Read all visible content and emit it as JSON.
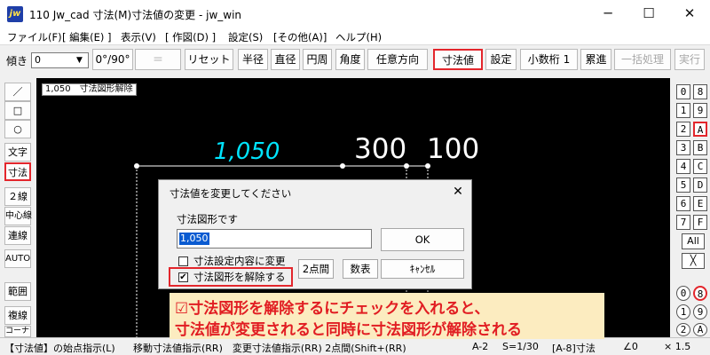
{
  "window": {
    "logo": "jw",
    "title": "110 Jw_cad 寸法(M)寸法値の変更 - jw_win",
    "minimize_glyph": "─",
    "maximize_glyph": "☐",
    "close_glyph": "✕"
  },
  "menu": [
    "ファイル(F)",
    "[ 編集(E) ]",
    "表示(V)",
    "[ 作図(D) ]",
    "設定(S)",
    "[その他(A)]",
    "ヘルプ(H)"
  ],
  "toolbar": {
    "tilt_label": "傾き",
    "tilt_value": "0",
    "angle_button": "0°/90°",
    "equals_button": "＝",
    "reset_button": "リセット",
    "radius_button": "半径",
    "diameter_button": "直径",
    "circumference_button": "円周",
    "angle2_button": "角度",
    "any_direction_button": "任意方向",
    "dimension_value_button": "寸法値",
    "settings_button": "設定",
    "decimals_button": "小数桁 1",
    "cumulative_button": "累進",
    "batch_button": "一括処理",
    "execute_button": "実行"
  },
  "left_tools": {
    "line": "／",
    "rect": "□",
    "circle": "○",
    "text": "文字",
    "dimension": "寸法",
    "double_line": "２線",
    "center_line": "中心線",
    "continuous_line": "連線",
    "auto": "AUTO",
    "range": "範囲",
    "copy": "複線",
    "corner": "コーナー"
  },
  "canvas": {
    "label": "1,050　寸法図形解除",
    "dim_cyan": "1,050",
    "dim_300": "300",
    "dim_100": "100"
  },
  "layers": {
    "left": [
      "0",
      "1",
      "2",
      "3",
      "4",
      "5",
      "6",
      "7"
    ],
    "right": [
      "8",
      "9",
      "A",
      "B",
      "C",
      "D",
      "E",
      "F"
    ],
    "all": "All",
    "cross": "╳",
    "group_left": [
      "⓪",
      "①",
      "②"
    ],
    "group_right": [
      "⑧",
      "⑨",
      "Ⓐ"
    ],
    "left_plain": [
      "0",
      "1",
      "2"
    ],
    "right_plain": [
      "8",
      "9",
      "A"
    ]
  },
  "dialog": {
    "title": "寸法値を変更してください",
    "close_glyph": "✕",
    "section_label": "寸法図形です",
    "input_value": "1,050",
    "ok_button": "OK",
    "option_change_settings": "寸法設定内容に変更",
    "option_change_settings_checked": false,
    "option_release_dimension": "寸法図形を解除する",
    "option_release_dimension_checked": true,
    "check_glyph": "✔",
    "two_point_button": "2点間",
    "number_table_button": "数表",
    "cancel_button": "ｷｬﾝｾﾙ"
  },
  "annotation": {
    "line1": "☑寸法図形を解除するにチェックを入れると、",
    "line2": "寸法値が変更されると同時に寸法図形が解除される"
  },
  "status": {
    "left": "【寸法値】の始点指示(L)",
    "middle": "移動寸法値指示(RR)　変更寸法値指示(RR)  2点間(Shift+(RR)",
    "scale_a": "A-2",
    "scale_b": "S=1/30",
    "layer": "[A-8]寸法",
    "angle": "∠0",
    "zoom": "× 1.5"
  },
  "colors": {
    "highlight_red": "#e3262c",
    "cyan": "#00e5ff",
    "annotation_bg": "#fcecc0",
    "annotation_text": "#e11d22"
  }
}
